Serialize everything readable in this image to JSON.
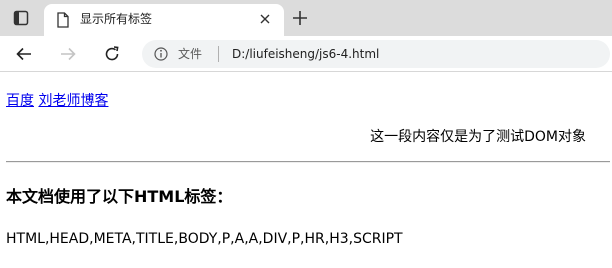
{
  "browser": {
    "tab": {
      "title": "显示所有标签"
    },
    "address_bar": {
      "scheme_label": "文件",
      "url": "D:/liufeisheng/js6-4.html"
    }
  },
  "page": {
    "links": [
      {
        "label": "百度"
      },
      {
        "label": "刘老师博客"
      }
    ],
    "paragraph": "这一段内容仅是为了测试DOM对象",
    "heading": "本文档使用了以下HTML标签：",
    "tag_list": "HTML,HEAD,META,TITLE,BODY,P,A,A,DIV,P,HR,H3,SCRIPT"
  },
  "icons": {
    "tab_actions": "tab-actions-icon",
    "page": "page-icon",
    "close": "close-icon",
    "new_tab": "plus-icon",
    "back": "arrow-left-icon",
    "forward": "arrow-right-icon",
    "reload": "reload-icon",
    "info": "info-icon"
  },
  "colors": {
    "link": "#0000ee",
    "tabstrip": "#dcdcdc",
    "address_bar": "#f1f3f4"
  }
}
